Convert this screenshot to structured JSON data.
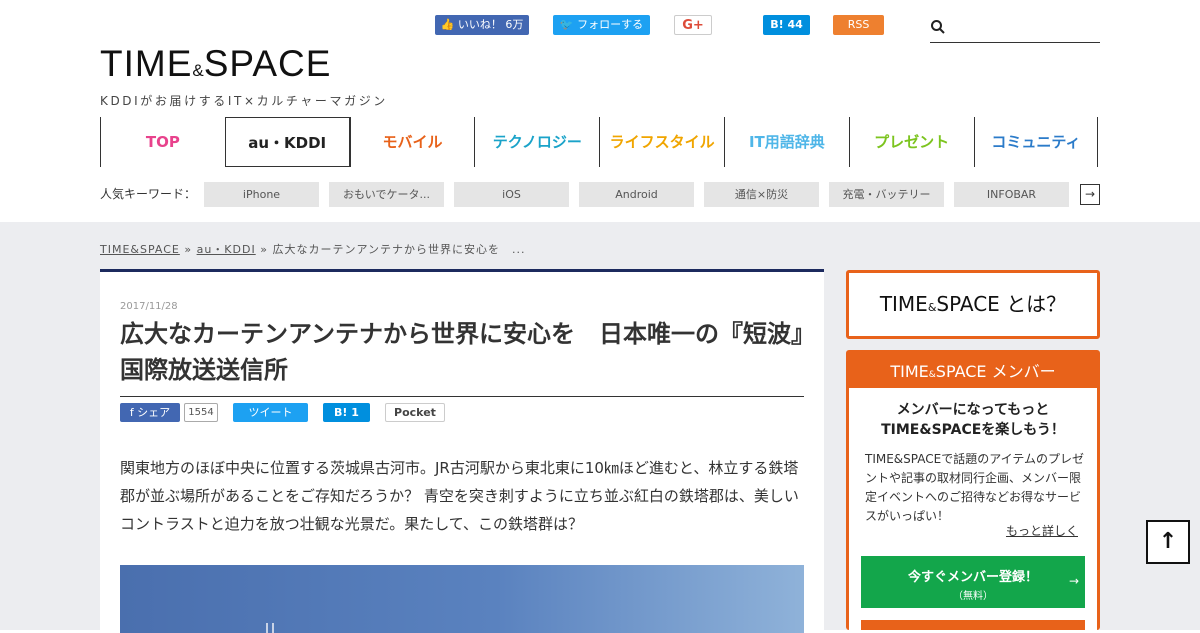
{
  "header": {
    "logo": {
      "word_left": "TIME",
      "word_amp": "&",
      "word_right": "SPACE",
      "tagline": "KDDIがお届けするIT×カルチャーマガジン"
    },
    "social": {
      "facebook": "👍 いいね！ 6万",
      "twitter": "🐦 フォローする",
      "googleplus": "G+",
      "hatena": "B! 44",
      "rss": "RSS"
    },
    "search": {
      "placeholder": ""
    },
    "nav": [
      {
        "label": "TOP",
        "color": "#e8428c"
      },
      {
        "label": "au・KDDI",
        "color": "#222222"
      },
      {
        "label": "モバイル",
        "color": "#e8621a"
      },
      {
        "label": "テクノロジー",
        "color": "#1aa3c9"
      },
      {
        "label": "ライフスタイル",
        "color": "#f0a500"
      },
      {
        "label": "IT用語辞典",
        "color": "#4fb6e8"
      },
      {
        "label": "プレゼント",
        "color": "#7cc41f"
      },
      {
        "label": "コミュニティ",
        "color": "#2b7bc9"
      }
    ],
    "keywords": {
      "label": "人気キーワード：",
      "items": [
        "iPhone",
        "おもいでケータ...",
        "iOS",
        "Android",
        "通信×防災",
        "充電・バッテリー",
        "INFOBAR"
      ],
      "more_arrow": "→"
    }
  },
  "breadcrumb": {
    "home": "TIME&SPACE",
    "sep1": "»",
    "category": "au・KDDI",
    "sep2": "»",
    "current": "広大なカーテンアンテナから世界に安心を　..."
  },
  "article": {
    "date": "2017/11/28",
    "title": "広大なカーテンアンテナから世界に安心を　日本唯一の『短波』国際放送送信所",
    "share": {
      "facebook": "f シェア",
      "facebook_count": "1554",
      "twitter": "ツイート",
      "hatena": "B! 1",
      "pocket": "Pocket"
    },
    "lead": "関東地方のほぼ中央に位置する茨城県古河市。JR古河駅から東北東に10㎞ほど進むと、林立する鉄塔郡が並ぶ場所があることをご存知だろうか？ 青空を突き刺すように立ち並ぶ紅白の鉄塔郡は、美しいコントラストと迫力を放つ壮観な光景だ。果たして、この鉄塔群は？"
  },
  "sidebar": {
    "about": {
      "word_left": "TIME",
      "word_amp": "&",
      "word_right": "SPACE",
      "suffix": "とは？"
    },
    "member": {
      "head_left": "TIME",
      "head_amp": "&",
      "head_right": "SPACE",
      "head_suffix": " メンバー",
      "lead_line1": "メンバーになってもっと",
      "lead_line2": "TIME&SPACEを楽しもう！",
      "desc": "TIME&SPACEで話題のアイテムのプレゼントや記事の取材同行企画、メンバー限定イベントへのご招待などお得なサービスがいっぱい！",
      "more": "もっと詳しく",
      "signup_main": "今すぐメンバー登録！",
      "signup_sub": "（無料）",
      "signup_arrow": "→"
    }
  },
  "back_to_top": "↑"
}
